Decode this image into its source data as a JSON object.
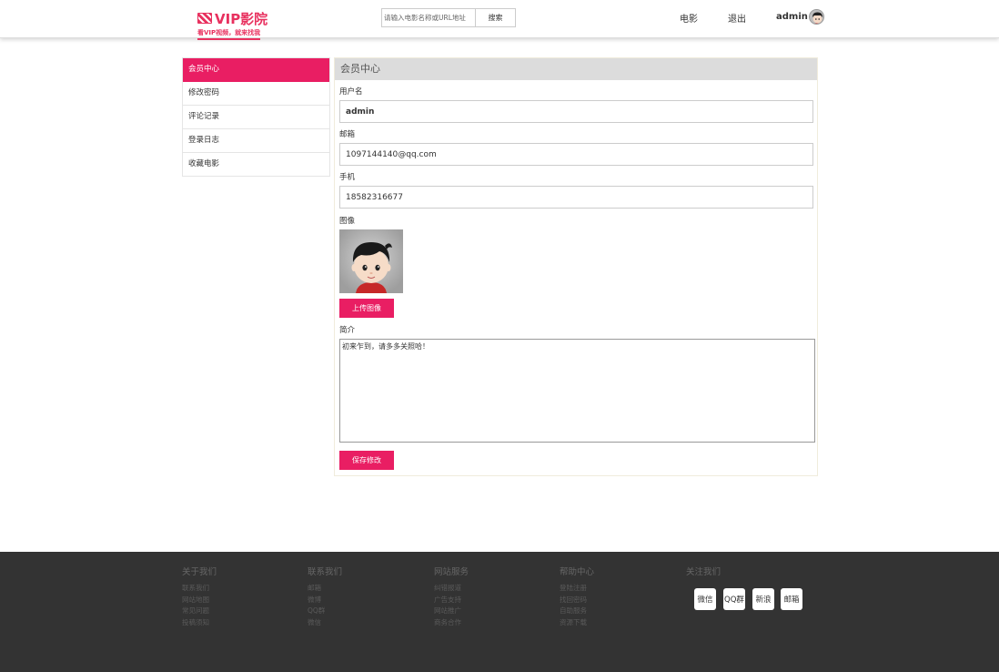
{
  "header": {
    "logo_text": "VIP影院",
    "logo_slogan": "看VIP视频，就来找我",
    "search_placeholder": "请输入电影名称或URL地址",
    "search_button": "搜索",
    "nav_movies": "电影",
    "nav_logout": "退出",
    "username": "admin"
  },
  "sidebar": {
    "items": [
      {
        "label": "会员中心",
        "active": true
      },
      {
        "label": "修改密码",
        "active": false
      },
      {
        "label": "评论记录",
        "active": false
      },
      {
        "label": "登录日志",
        "active": false
      },
      {
        "label": "收藏电影",
        "active": false
      }
    ]
  },
  "profile": {
    "title": "会员中心",
    "username_label": "用户名",
    "username_value": "admin",
    "email_label": "邮箱",
    "email_value": "1097144140@qq.com",
    "phone_label": "手机",
    "phone_value": "18582316677",
    "avatar_label": "图像",
    "upload_button": "上传图像",
    "bio_label": "简介",
    "bio_value": "初来乍到，请多多关照哈！",
    "save_button": "保存修改"
  },
  "footer": {
    "columns": [
      {
        "title": "关于我们",
        "links": [
          "联系我们",
          "网站地图",
          "常见问题",
          "投稿须知"
        ]
      },
      {
        "title": "联系我们",
        "links": [
          "邮箱",
          "微博",
          "QQ群",
          "微信"
        ]
      },
      {
        "title": "网站服务",
        "links": [
          "纠错报道",
          "广告支持",
          "网站推广",
          "商务合作"
        ]
      },
      {
        "title": "帮助中心",
        "links": [
          "登陆注册",
          "找回密码",
          "自助服务",
          "资源下载"
        ]
      }
    ],
    "follow_title": "关注我们",
    "social": [
      "微信",
      "QQ群",
      "新浪",
      "邮箱"
    ]
  },
  "colors": {
    "accent": "#e91e63",
    "footer_bg": "#333333",
    "panel_header_bg": "#dcdcdc"
  }
}
